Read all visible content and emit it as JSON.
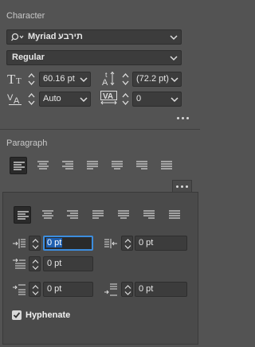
{
  "character": {
    "title": "Character",
    "font_family": "תירבע",
    "font_family_prefix": "Myriad",
    "font_style": "Regular",
    "font_size": "60.16 pt",
    "leading": "(72.2 pt)",
    "kerning": "Auto",
    "tracking": "0"
  },
  "paragraph": {
    "title": "Paragraph"
  },
  "popup": {
    "left_indent": "0 pt",
    "right_indent": "0 pt",
    "first_line_indent": "0 pt",
    "space_before": "0 pt",
    "space_after": "0 pt",
    "hyphenate_label": "Hyphenate",
    "hyphenate_checked": true
  }
}
